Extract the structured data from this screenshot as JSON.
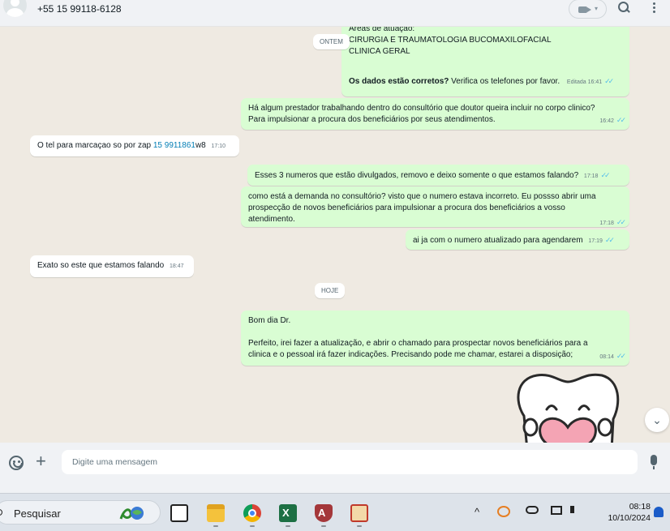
{
  "header": {
    "contact_name": "+55 15 99118-6128"
  },
  "chat": {
    "date_pills": {
      "yesterday": "ONTEM",
      "today": "HOJE"
    },
    "msg1": {
      "line0": "Áreas de atuação:",
      "line1": "CIRURGIA E TRAUMATOLOGIA BUCOMAXILOFACIAL",
      "line2": "CLINICA GERAL",
      "bold": "Os dados estão corretos?",
      "rest": " Verifica os telefones por favor.",
      "edited": "Editada",
      "time": "16:41"
    },
    "msg2": {
      "line1": "Há algum prestador trabalhando dentro do consultório que doutor queira incluir no corpo clinico?",
      "line2": "Para impulsionar a procura dos beneficiários por seus atendimentos.",
      "time": "16:42"
    },
    "msg3": {
      "text": "O tel para marcaçao so por zap ",
      "link": "15 9911861",
      "suffix": "w8",
      "time": "17:10"
    },
    "msg4": {
      "text": "Esses 3 numeros que estão divulgados, removo e deixo somente o que estamos falando?",
      "time": "17:18"
    },
    "msg5": {
      "line1": "como está a demanda no consultório? visto que o numero estava incorreto. Eu possso abrir uma",
      "line2": "prospecção de novos beneficiários para impulsionar a procura dos beneficiários a vosso",
      "line3": "atendimento.",
      "time": "17:18"
    },
    "msg6": {
      "text": "ai ja com o numero atualizado para agendarem",
      "time": "17:19"
    },
    "msg7": {
      "text": "Exato so este que estamos falando",
      "time": "18:47"
    },
    "msg8": {
      "line1": "Bom dia Dr.",
      "line2": "Perfeito, irei fazer a atualização, e abrir o chamado para prospectar novos beneficiários para a",
      "line3": "clinica e o pessoal irá fazer indicações. Precisando pode me chamar, estarei a disposição;",
      "time": "08:14"
    },
    "tick_glyph": "✓✓",
    "scroll_glyph": "⌄"
  },
  "composer": {
    "placeholder": "Digite uma mensagem",
    "plus_glyph": "+"
  },
  "taskbar": {
    "search_label": "Pesquisar",
    "time": "08:18",
    "date": "10/10/2024",
    "tray_caret": "^"
  },
  "colors": {
    "outgoing": "#d9fdd3",
    "incoming": "#ffffff",
    "chat_bg": "#efeae2",
    "tick": "#53bdeb"
  },
  "icons": [
    "avatar-icon",
    "video-call-icon",
    "search-icon",
    "menu-icon",
    "tooth-sticker",
    "scroll-down-icon",
    "emoji-icon",
    "attach-plus-icon",
    "mic-icon",
    "taskbar-search-icon",
    "ribbon-globe-icon",
    "task-view-icon",
    "file-explorer-icon",
    "chrome-icon",
    "excel-icon",
    "access-icon",
    "network-tool-icon",
    "tray-chevron-icon",
    "sync-icon",
    "cloud-off-icon",
    "display-icon",
    "volume-icon",
    "notification-bell-icon"
  ]
}
